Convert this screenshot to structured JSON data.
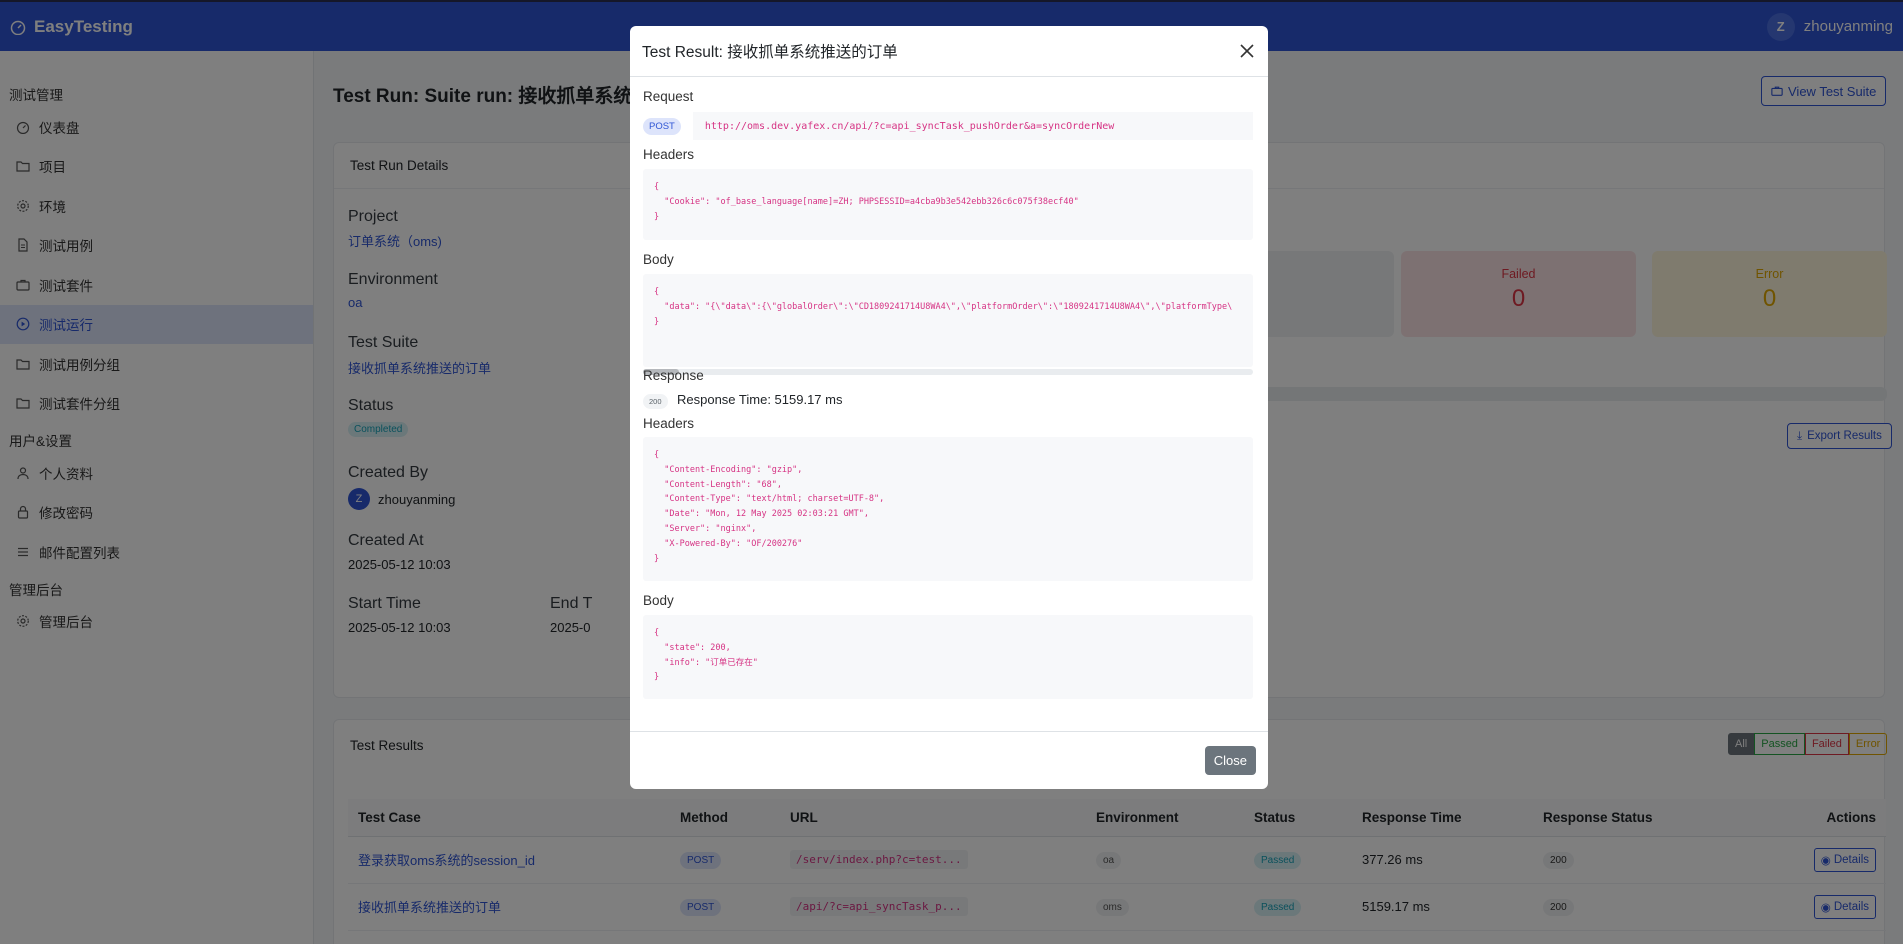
{
  "app": {
    "name": "EasyTesting",
    "user_name": "zhouyanming",
    "user_initial": "Z"
  },
  "sidebar": {
    "groups": [
      {
        "label": "测试管理",
        "items": [
          {
            "label": "仪表盘",
            "icon": "dashboard-icon"
          },
          {
            "label": "项目",
            "icon": "folder-icon"
          },
          {
            "label": "环境",
            "icon": "gear-icon"
          },
          {
            "label": "测试用例",
            "icon": "file-icon"
          },
          {
            "label": "测试套件",
            "icon": "briefcase-icon"
          },
          {
            "label": "测试运行",
            "icon": "play-circle-icon",
            "active": true
          },
          {
            "label": "测试用例分组",
            "icon": "folder-icon"
          },
          {
            "label": "测试套件分组",
            "icon": "folder-icon"
          }
        ]
      },
      {
        "label": "用户&设置",
        "items": [
          {
            "label": "个人资料",
            "icon": "person-icon"
          },
          {
            "label": "修改密码",
            "icon": "lock-icon"
          },
          {
            "label": "邮件配置列表",
            "icon": "list-icon"
          }
        ]
      },
      {
        "label": "管理后台",
        "items": [
          {
            "label": "管理后台",
            "icon": "gear-icon"
          }
        ]
      }
    ]
  },
  "page": {
    "title": "Test Run: Suite run: 接收抓单系统推",
    "view_suite_button": "View Test Suite",
    "details_card": {
      "title": "Test Run Details",
      "project_label": "Project",
      "project_value": "订单系统（oms)",
      "environment_label": "Environment",
      "environment_value": "oa",
      "suite_label": "Test Suite",
      "suite_value": "接收抓单系统推送的订单",
      "status_label": "Status",
      "status_value": "Completed",
      "created_by_label": "Created By",
      "created_by_value": "zhouyanming",
      "created_by_initial": "Z",
      "created_at_label": "Created At",
      "created_at_value": "2025-05-12 10:03",
      "start_time_label": "Start Time",
      "start_time_value": "2025-05-12 10:03",
      "end_time_label": "End T",
      "end_time_value": "2025-0"
    },
    "stats": {
      "failed_label": "Failed",
      "failed_value": "0",
      "error_label": "Error",
      "error_value": "0"
    },
    "export_button": "Export Results",
    "results_card": {
      "title": "Test Results",
      "filters": [
        "All",
        "Passed",
        "Failed",
        "Error"
      ],
      "columns": [
        "Test Case",
        "Method",
        "URL",
        "Environment",
        "Status",
        "Response Time",
        "Response Status",
        "Actions"
      ],
      "rows": [
        {
          "name": "登录获取oms系统的session_id",
          "method": "POST",
          "url": "/serv/index.php?c=test...",
          "env": "oa",
          "status": "Passed",
          "time": "377.26 ms",
          "code": "200",
          "action": "Details"
        },
        {
          "name": "接收抓单系统推送的订单",
          "method": "POST",
          "url": "/api/?c=api_syncTask_p...",
          "env": "oms",
          "status": "Passed",
          "time": "5159.17 ms",
          "code": "200",
          "action": "Details"
        }
      ]
    }
  },
  "modal": {
    "title": "Test Result: 接收抓单系统推送的订单",
    "request_label": "Request",
    "method": "POST",
    "url": "http://oms.dev.yafex.cn/api/?c=api_syncTask_pushOrder&a=syncOrderNew",
    "headers_label": "Headers",
    "request_headers": "{\n  \"Cookie\": \"of_base_language[name]=ZH; PHPSESSID=a4cba9b3e542ebb326c6c075f38ecf40\"\n}",
    "body_label": "Body",
    "request_body": "{\n  \"data\": \"{\\\"data\\\":{\\\"globalOrder\\\":\\\"CD1809241714U8WA4\\\",\\\"platformOrder\\\":\\\"1809241714U8WA4\\\",\\\"platformType\\\n}",
    "response_label": "Response",
    "response_status": "200",
    "response_time": "Response Time: 5159.17 ms",
    "response_headers_label": "Headers",
    "response_headers": "{\n  \"Content-Encoding\": \"gzip\",\n  \"Content-Length\": \"68\",\n  \"Content-Type\": \"text/html; charset=UTF-8\",\n  \"Date\": \"Mon, 12 May 2025 02:03:21 GMT\",\n  \"Server\": \"nginx\",\n  \"X-Powered-By\": \"OF/200276\"\n}",
    "response_body_label": "Body",
    "response_body": "{\n  \"state\": 200,\n  \"info\": \"订单已存在\"\n}",
    "close_button": "Close"
  }
}
